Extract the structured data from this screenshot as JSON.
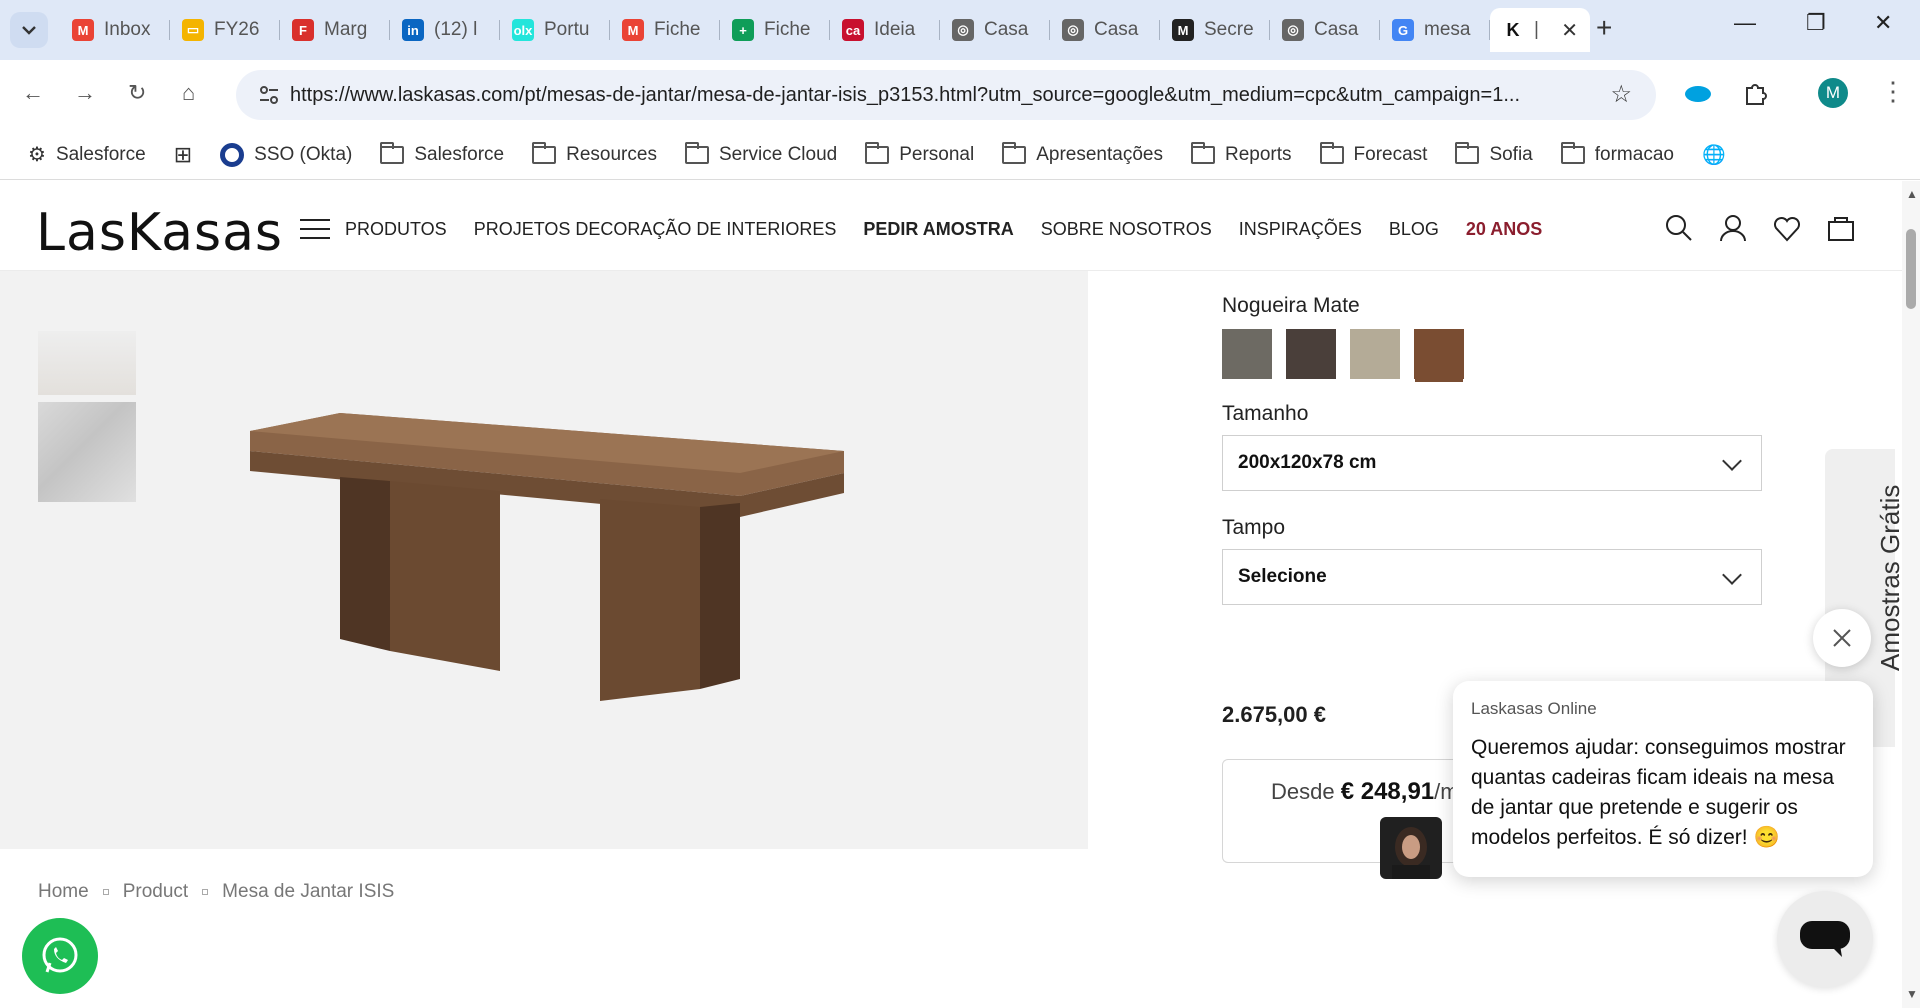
{
  "browser": {
    "tabs": [
      {
        "title": "Inbox",
        "icon": "gmail-icon",
        "color": "#ea4335",
        "glyph": "M"
      },
      {
        "title": "FY26",
        "icon": "slides-icon",
        "color": "#f4b400",
        "glyph": "▭"
      },
      {
        "title": "Marg",
        "icon": "f-icon",
        "color": "#d9302c",
        "glyph": "F"
      },
      {
        "title": "(12) l",
        "icon": "linkedin-icon",
        "color": "#0a66c2",
        "glyph": "in"
      },
      {
        "title": "Portu",
        "icon": "olx-icon",
        "color": "#23e5db",
        "glyph": "olx"
      },
      {
        "title": "Fiche",
        "icon": "gmail-icon",
        "color": "#ea4335",
        "glyph": "M"
      },
      {
        "title": "Fiche",
        "icon": "sheets-icon",
        "color": "#0f9d58",
        "glyph": "+"
      },
      {
        "title": "Ideia",
        "icon": "casa-icon",
        "color": "#c8102e",
        "glyph": "ca"
      },
      {
        "title": "Casa",
        "icon": "globe-icon",
        "color": "#666666",
        "glyph": "◎"
      },
      {
        "title": "Casa",
        "icon": "globe-icon",
        "color": "#666666",
        "glyph": "◎"
      },
      {
        "title": "Secre",
        "icon": "m-icon",
        "color": "#222222",
        "glyph": "M"
      },
      {
        "title": "Casa",
        "icon": "globe-icon",
        "color": "#666666",
        "glyph": "◎"
      },
      {
        "title": "mesa",
        "icon": "google-icon",
        "color": "#4285f4",
        "glyph": "G"
      }
    ],
    "active_tab": {
      "title": "|",
      "icon": "laskasas-icon",
      "glyph": "K"
    },
    "url": "https://www.laskasas.com/pt/mesas-de-jantar/mesa-de-jantar-isis_p3153.html?utm_source=google&utm_medium=cpc&utm_campaign=1...",
    "profile_initial": "M",
    "bookmarks": [
      {
        "label": "Salesforce",
        "type": "app"
      },
      {
        "label": "",
        "type": "apps-grid"
      },
      {
        "label": "SSO (Okta)",
        "type": "okta"
      },
      {
        "label": "Salesforce",
        "type": "folder"
      },
      {
        "label": "Resources",
        "type": "folder"
      },
      {
        "label": "Service Cloud",
        "type": "folder"
      },
      {
        "label": "Personal",
        "type": "folder"
      },
      {
        "label": "Apresentações",
        "type": "folder"
      },
      {
        "label": "Reports",
        "type": "folder"
      },
      {
        "label": "Forecast",
        "type": "folder"
      },
      {
        "label": "Sofia",
        "type": "folder"
      },
      {
        "label": "formacao",
        "type": "folder"
      }
    ]
  },
  "site": {
    "logo": "LasKasas",
    "nav": [
      "PRODUTOS",
      "PROJETOS DECORAÇÃO DE INTERIORES",
      "PEDIR AMOSTRA",
      "SOBRE NOSOTROS",
      "INSPIRAÇÕES",
      "BLOG",
      "20 ANOS"
    ],
    "finish_label": "Nogueira Mate",
    "swatches": [
      "#6d6a63",
      "#4a3f3a",
      "#b4ab97",
      "#7a4d32"
    ],
    "size_label": "Tamanho",
    "size_value": "200x120x78 cm",
    "top_label": "Tampo",
    "top_value": "Selecione",
    "price": "2.675,00 €",
    "finance_prefix": "Desde",
    "finance_amount": "€ 248,91",
    "finance_suffix": "/m",
    "breadcrumb": [
      "Home",
      "Product",
      "Mesa de Jantar ISIS"
    ],
    "side_tab": "Amostras Grátis",
    "chat": {
      "name": "Laskasas Online",
      "message": "Queremos ajudar: conseguimos mostrar quantas cadeiras ficam ideais na mesa de jantar que pretende e sugerir os modelos perfeitos. É só dizer! 😊"
    }
  }
}
